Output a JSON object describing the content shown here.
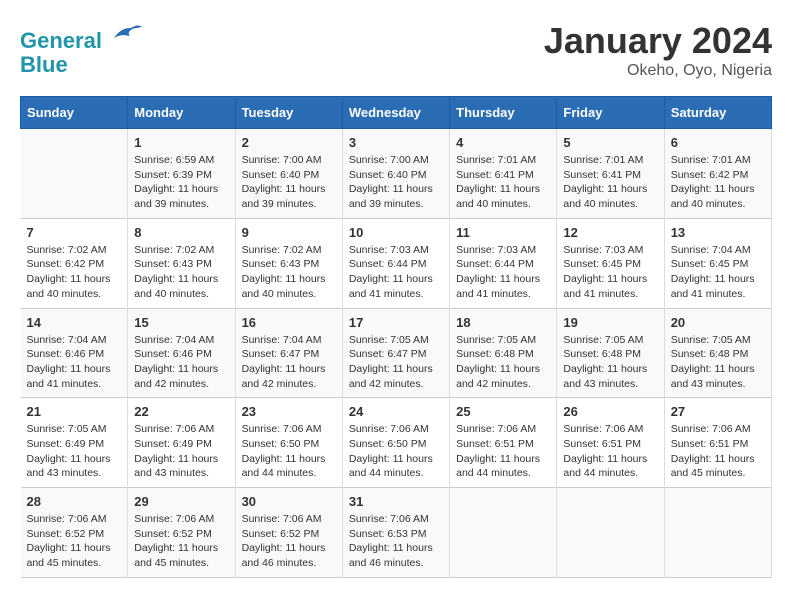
{
  "header": {
    "logo_line1": "General",
    "logo_line2": "Blue",
    "title": "January 2024",
    "subtitle": "Okeho, Oyo, Nigeria"
  },
  "weekdays": [
    "Sunday",
    "Monday",
    "Tuesday",
    "Wednesday",
    "Thursday",
    "Friday",
    "Saturday"
  ],
  "weeks": [
    [
      {
        "day": "",
        "info": ""
      },
      {
        "day": "1",
        "info": "Sunrise: 6:59 AM\nSunset: 6:39 PM\nDaylight: 11 hours\nand 39 minutes."
      },
      {
        "day": "2",
        "info": "Sunrise: 7:00 AM\nSunset: 6:40 PM\nDaylight: 11 hours\nand 39 minutes."
      },
      {
        "day": "3",
        "info": "Sunrise: 7:00 AM\nSunset: 6:40 PM\nDaylight: 11 hours\nand 39 minutes."
      },
      {
        "day": "4",
        "info": "Sunrise: 7:01 AM\nSunset: 6:41 PM\nDaylight: 11 hours\nand 40 minutes."
      },
      {
        "day": "5",
        "info": "Sunrise: 7:01 AM\nSunset: 6:41 PM\nDaylight: 11 hours\nand 40 minutes."
      },
      {
        "day": "6",
        "info": "Sunrise: 7:01 AM\nSunset: 6:42 PM\nDaylight: 11 hours\nand 40 minutes."
      }
    ],
    [
      {
        "day": "7",
        "info": "Sunrise: 7:02 AM\nSunset: 6:42 PM\nDaylight: 11 hours\nand 40 minutes."
      },
      {
        "day": "8",
        "info": "Sunrise: 7:02 AM\nSunset: 6:43 PM\nDaylight: 11 hours\nand 40 minutes."
      },
      {
        "day": "9",
        "info": "Sunrise: 7:02 AM\nSunset: 6:43 PM\nDaylight: 11 hours\nand 40 minutes."
      },
      {
        "day": "10",
        "info": "Sunrise: 7:03 AM\nSunset: 6:44 PM\nDaylight: 11 hours\nand 41 minutes."
      },
      {
        "day": "11",
        "info": "Sunrise: 7:03 AM\nSunset: 6:44 PM\nDaylight: 11 hours\nand 41 minutes."
      },
      {
        "day": "12",
        "info": "Sunrise: 7:03 AM\nSunset: 6:45 PM\nDaylight: 11 hours\nand 41 minutes."
      },
      {
        "day": "13",
        "info": "Sunrise: 7:04 AM\nSunset: 6:45 PM\nDaylight: 11 hours\nand 41 minutes."
      }
    ],
    [
      {
        "day": "14",
        "info": "Sunrise: 7:04 AM\nSunset: 6:46 PM\nDaylight: 11 hours\nand 41 minutes."
      },
      {
        "day": "15",
        "info": "Sunrise: 7:04 AM\nSunset: 6:46 PM\nDaylight: 11 hours\nand 42 minutes."
      },
      {
        "day": "16",
        "info": "Sunrise: 7:04 AM\nSunset: 6:47 PM\nDaylight: 11 hours\nand 42 minutes."
      },
      {
        "day": "17",
        "info": "Sunrise: 7:05 AM\nSunset: 6:47 PM\nDaylight: 11 hours\nand 42 minutes."
      },
      {
        "day": "18",
        "info": "Sunrise: 7:05 AM\nSunset: 6:48 PM\nDaylight: 11 hours\nand 42 minutes."
      },
      {
        "day": "19",
        "info": "Sunrise: 7:05 AM\nSunset: 6:48 PM\nDaylight: 11 hours\nand 43 minutes."
      },
      {
        "day": "20",
        "info": "Sunrise: 7:05 AM\nSunset: 6:48 PM\nDaylight: 11 hours\nand 43 minutes."
      }
    ],
    [
      {
        "day": "21",
        "info": "Sunrise: 7:05 AM\nSunset: 6:49 PM\nDaylight: 11 hours\nand 43 minutes."
      },
      {
        "day": "22",
        "info": "Sunrise: 7:06 AM\nSunset: 6:49 PM\nDaylight: 11 hours\nand 43 minutes."
      },
      {
        "day": "23",
        "info": "Sunrise: 7:06 AM\nSunset: 6:50 PM\nDaylight: 11 hours\nand 44 minutes."
      },
      {
        "day": "24",
        "info": "Sunrise: 7:06 AM\nSunset: 6:50 PM\nDaylight: 11 hours\nand 44 minutes."
      },
      {
        "day": "25",
        "info": "Sunrise: 7:06 AM\nSunset: 6:51 PM\nDaylight: 11 hours\nand 44 minutes."
      },
      {
        "day": "26",
        "info": "Sunrise: 7:06 AM\nSunset: 6:51 PM\nDaylight: 11 hours\nand 44 minutes."
      },
      {
        "day": "27",
        "info": "Sunrise: 7:06 AM\nSunset: 6:51 PM\nDaylight: 11 hours\nand 45 minutes."
      }
    ],
    [
      {
        "day": "28",
        "info": "Sunrise: 7:06 AM\nSunset: 6:52 PM\nDaylight: 11 hours\nand 45 minutes."
      },
      {
        "day": "29",
        "info": "Sunrise: 7:06 AM\nSunset: 6:52 PM\nDaylight: 11 hours\nand 45 minutes."
      },
      {
        "day": "30",
        "info": "Sunrise: 7:06 AM\nSunset: 6:52 PM\nDaylight: 11 hours\nand 46 minutes."
      },
      {
        "day": "31",
        "info": "Sunrise: 7:06 AM\nSunset: 6:53 PM\nDaylight: 11 hours\nand 46 minutes."
      },
      {
        "day": "",
        "info": ""
      },
      {
        "day": "",
        "info": ""
      },
      {
        "day": "",
        "info": ""
      }
    ]
  ]
}
